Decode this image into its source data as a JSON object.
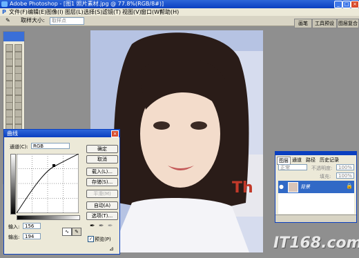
{
  "window": {
    "title": "Adobe Photoshop - [图1 照片素材.jpg @ 77.8%(RGB/8#)]"
  },
  "menu": [
    "文件(F)",
    "编辑(E)",
    "图像(I)",
    "图层(L)",
    "选择(S)",
    "滤镜(T)",
    "视图(V)",
    "窗口(W)",
    "帮助(H)"
  ],
  "options": {
    "sample_label": "取样大小:",
    "sample_value": "取样点"
  },
  "palette_tabs": [
    "画笔",
    "工具预设",
    "图层复合"
  ],
  "curves": {
    "title": "曲线",
    "channel_label": "通道(C):",
    "channel_value": "RGB",
    "buttons": [
      "确定",
      "取消",
      "载入(L)...",
      "存储(S)...",
      "平滑(M)",
      "自动(A)",
      "选项(T)..."
    ],
    "input_label": "输入:",
    "input_value": "156",
    "output_label": "输出:",
    "output_value": "194",
    "preview_label": "预览(P)"
  },
  "layers": {
    "tabs": [
      "图层",
      "通道",
      "路径",
      "历史记录"
    ],
    "blend_mode": "正常",
    "opacity_label": "不透明度:",
    "opacity_value": "100%",
    "fill_label": "填充:",
    "fill_value": "100%",
    "layer_name": "背景"
  },
  "watermark": "IT168.com",
  "colors": {
    "title_bar": "#0a3fc0",
    "dialog_bg": "#ece9d8",
    "workspace": "#8f8f8f"
  }
}
